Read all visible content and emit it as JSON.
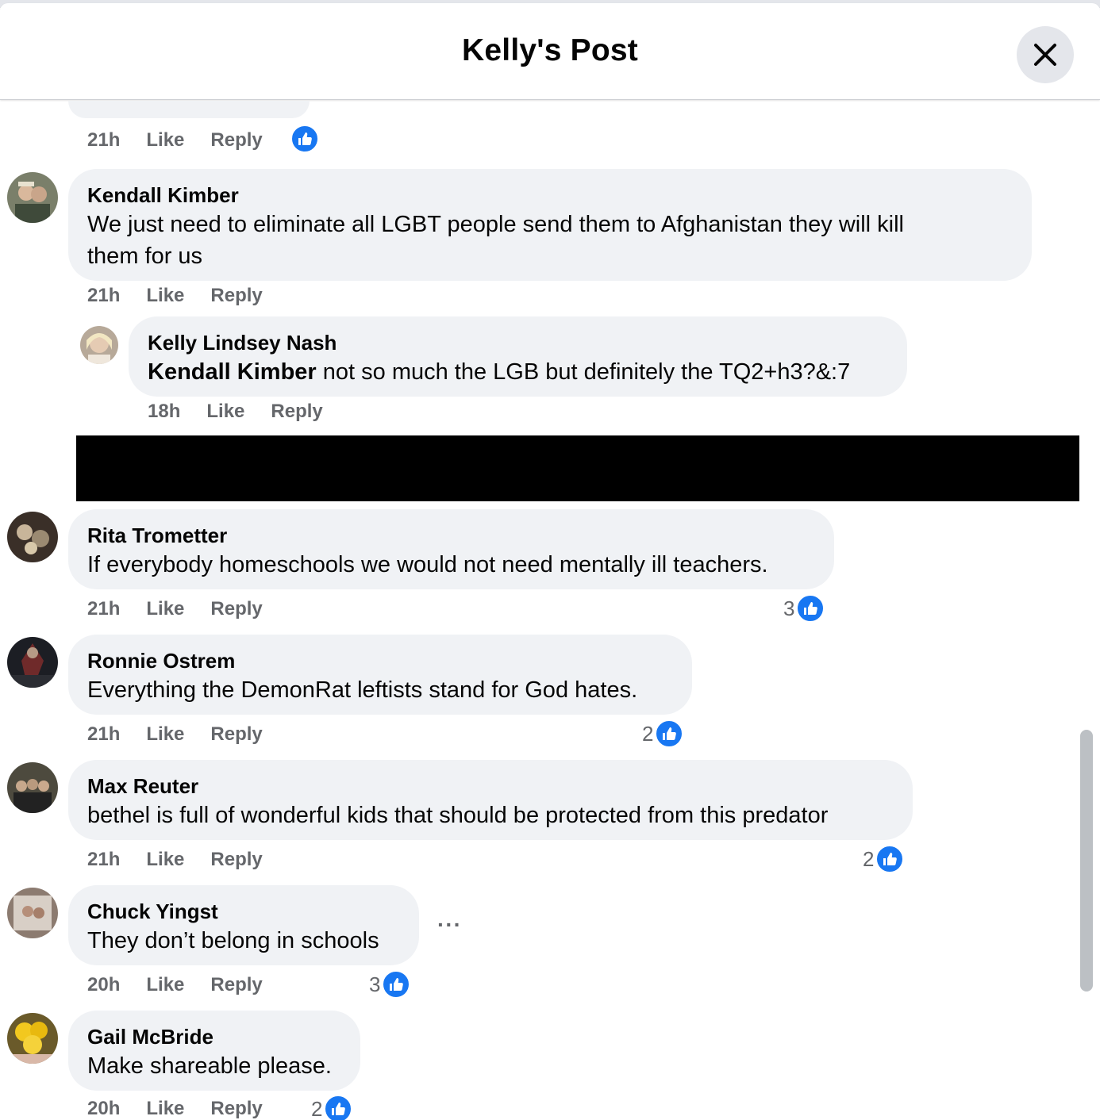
{
  "header": {
    "title": "Kelly's Post"
  },
  "colors": {
    "like_blue": "#1877f2",
    "bubble_bg": "#f0f2f5",
    "meta_gray": "#65676b"
  },
  "icons": {
    "close": "close-icon",
    "like": "thumbs-up-icon",
    "more": "more-options-icon"
  },
  "prev_comment": {
    "time": "21h",
    "like": "Like",
    "reply": "Reply"
  },
  "comments": [
    {
      "author": "Kendall Kimber",
      "text_line1": "We just need to eliminate all LGBT people send them to Afghanistan they will kill",
      "text_line2": "them for us",
      "time": "21h",
      "like": "Like",
      "reply": "Reply",
      "reply_item": {
        "author": "Kelly Lindsey Nash",
        "mention": "Kendall Kimber",
        "text": " not so much the LGB but definitely the TQ2+h3?&:7",
        "time": "18h",
        "like": "Like",
        "reply": "Reply"
      }
    },
    {
      "author": "Rita Trometter",
      "text": "If everybody homeschools we would not need mentally ill teachers.",
      "time": "21h",
      "like": "Like",
      "reply": "Reply",
      "reactions": "3"
    },
    {
      "author": "Ronnie Ostrem",
      "text": "Everything the DemonRat leftists stand for God hates.",
      "time": "21h",
      "like": "Like",
      "reply": "Reply",
      "reactions": "2"
    },
    {
      "author": "Max Reuter",
      "text": "bethel is full of wonderful kids that should be protected from this predator",
      "time": "21h",
      "like": "Like",
      "reply": "Reply",
      "reactions": "2"
    },
    {
      "author": "Chuck Yingst",
      "text": "They don’t belong in schools",
      "time": "20h",
      "like": "Like",
      "reply": "Reply",
      "reactions": "3",
      "more": "···"
    },
    {
      "author": "Gail McBride",
      "text": "Make shareable please.",
      "time": "20h",
      "like": "Like",
      "reply": "Reply",
      "reactions": "2"
    }
  ]
}
